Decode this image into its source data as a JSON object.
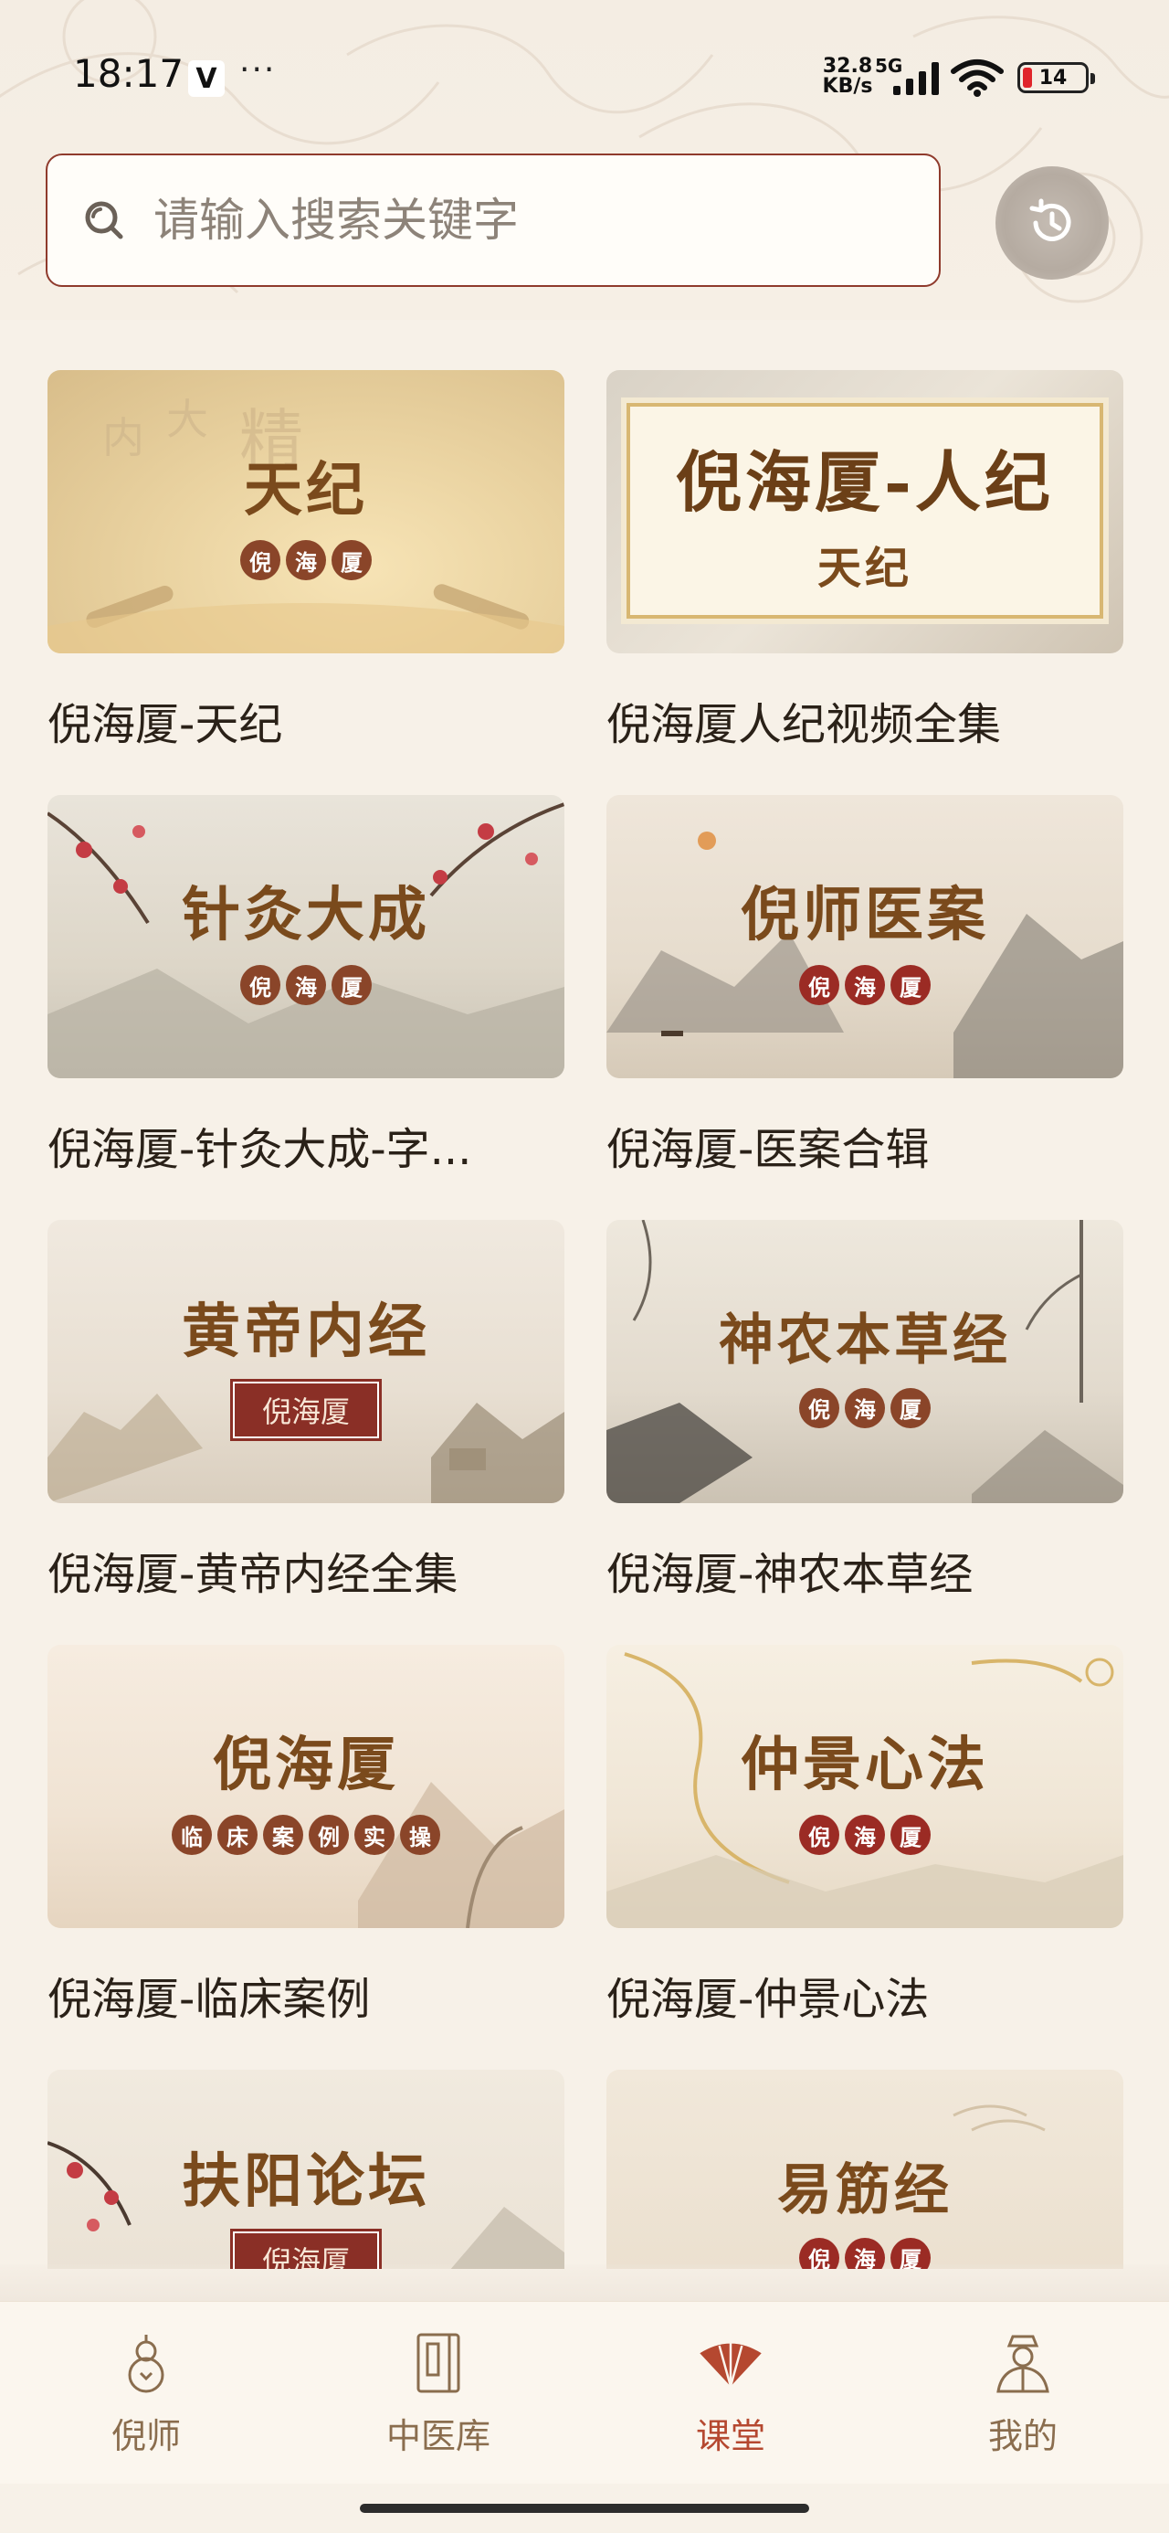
{
  "status_bar": {
    "time": "18:17",
    "app_icon": "V",
    "more": "···",
    "speed_value": "32.8",
    "speed_unit": "KB/s",
    "network": "5G",
    "battery": "14"
  },
  "search": {
    "placeholder": "请输入搜索关键字"
  },
  "courses": [
    {
      "thumb_title": "天纪",
      "badge": [
        "倪",
        "海",
        "厦"
      ],
      "title": "倪海厦-天纪"
    },
    {
      "thumb_title": "倪海厦-人纪",
      "thumb_subtitle": "天纪",
      "title": "倪海厦人纪视频全集"
    },
    {
      "thumb_title": "针灸大成",
      "badge": [
        "倪",
        "海",
        "厦"
      ],
      "title": "倪海厦-针灸大成-字..."
    },
    {
      "thumb_title": "倪师医案",
      "badge": [
        "倪",
        "海",
        "厦"
      ],
      "title": "倪海厦-医案合辑"
    },
    {
      "thumb_title": "黄帝内经",
      "badge_text": "倪海厦",
      "title": "倪海厦-黄帝内经全集"
    },
    {
      "thumb_title": "神农本草经",
      "badge": [
        "倪",
        "海",
        "厦"
      ],
      "title": "倪海厦-神农本草经"
    },
    {
      "thumb_title": "倪海厦",
      "badge": [
        "临",
        "床",
        "案",
        "例",
        "实",
        "操"
      ],
      "title": "倪海厦-临床案例"
    },
    {
      "thumb_title": "仲景心法",
      "badge": [
        "倪",
        "海",
        "厦"
      ],
      "title": "倪海厦-仲景心法"
    },
    {
      "thumb_title": "扶阳论坛",
      "badge_text": "倪海厦",
      "title": ""
    },
    {
      "thumb_title": "易筋经",
      "badge": [
        "倪",
        "海",
        "厦"
      ],
      "title": ""
    }
  ],
  "tabs": [
    {
      "label": "倪师",
      "icon": "gourd-icon",
      "active": false
    },
    {
      "label": "中医库",
      "icon": "book-icon",
      "active": false
    },
    {
      "label": "课堂",
      "icon": "fan-icon",
      "active": true
    },
    {
      "label": "我的",
      "icon": "scholar-icon",
      "active": false
    }
  ],
  "colors": {
    "accent": "#b54830",
    "search_border": "#8f3a2c",
    "background": "#f7f1e8",
    "title_gold": "#7a4a1c"
  }
}
